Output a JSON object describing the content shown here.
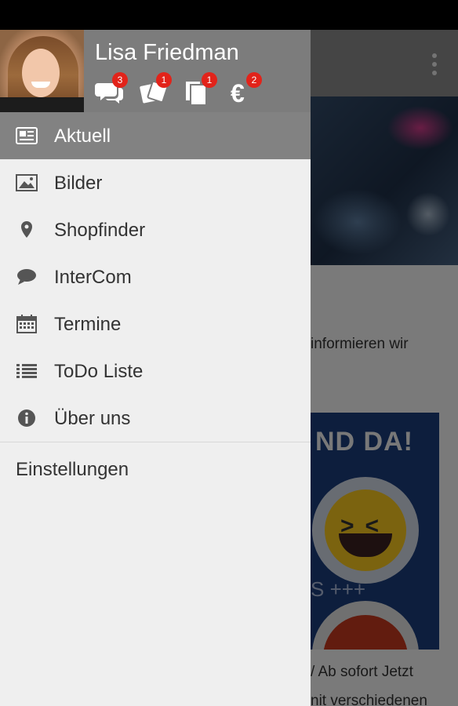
{
  "user": {
    "name": "Lisa Friedman"
  },
  "header_icons": [
    {
      "icon": "chat-bubbles-icon",
      "badge": "3"
    },
    {
      "icon": "tickets-icon",
      "badge": "1"
    },
    {
      "icon": "documents-icon",
      "badge": "1"
    },
    {
      "icon": "euro-icon",
      "badge": "2"
    }
  ],
  "menu": {
    "items": [
      {
        "label": "Aktuell",
        "icon": "newspaper-icon",
        "active": true
      },
      {
        "label": "Bilder",
        "icon": "image-icon"
      },
      {
        "label": "Shopfinder",
        "icon": "map-pin-icon"
      },
      {
        "label": "InterCom",
        "icon": "chat-bubble-icon"
      },
      {
        "label": "Termine",
        "icon": "calendar-icon"
      },
      {
        "label": "ToDo Liste",
        "icon": "list-icon"
      },
      {
        "label": "Über uns",
        "icon": "info-icon"
      }
    ],
    "settings": "Einstellungen"
  },
  "background": {
    "text1": "informieren wir",
    "promo_title": "ND DA!",
    "promo_plus": "S +++",
    "text2": "/ Ab sofort Jetzt",
    "text3": "nit verschiedenen"
  },
  "colors": {
    "badge": "#e2231a",
    "header": "#7c7c7c",
    "active_item": "#828282"
  }
}
